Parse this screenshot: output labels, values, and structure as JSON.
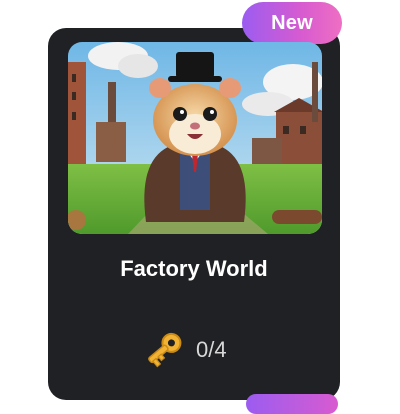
{
  "card": {
    "badge_label": "New",
    "title": "Factory World",
    "keys_progress": "0/4",
    "icon": "key-icon",
    "image_subject": "hamster-in-top-hat-factory"
  },
  "colors": {
    "card_bg": "#1f2124",
    "badge_start": "#9b5cf0",
    "badge_end": "#ee6fc2",
    "key_gold": "#f2b233"
  }
}
